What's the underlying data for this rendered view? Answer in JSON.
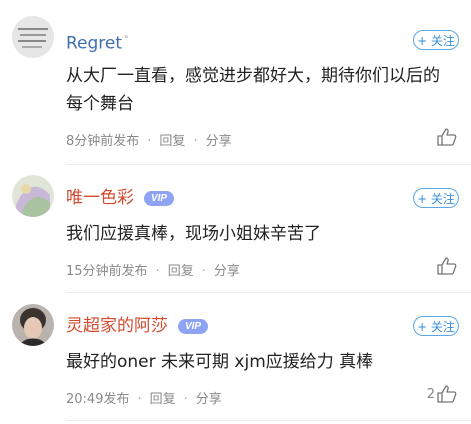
{
  "comments": [
    {
      "username": "Regret",
      "superscript": "°",
      "follow_label": "+ 关注",
      "vip": null,
      "text": "从大厂一直看，感觉进步都好大，期待你们以后的每个舞台",
      "time": "8分钟前发布",
      "reply_label": "回复",
      "share_label": "分享",
      "like_count": ""
    },
    {
      "username": "唯一色彩",
      "superscript": "",
      "follow_label": "+ 关注",
      "vip": "VIP",
      "text": "我们应援真棒，现场小姐妹辛苦了",
      "time": "15分钟前发布",
      "reply_label": "回复",
      "share_label": "分享",
      "like_count": ""
    },
    {
      "username": "灵超家的阿莎",
      "superscript": "",
      "follow_label": "+ 关注",
      "vip": "VIP",
      "text": "最好的oner  未来可期 xjm应援给力 真棒",
      "time": "20:49发布",
      "reply_label": "回复",
      "share_label": "分享",
      "like_count": "2"
    }
  ],
  "colors": {
    "name_normal": "#3f6fb0",
    "name_vip": "#d24b2e",
    "vip_badge": "#8fa3f5",
    "follow": "#3a8fd8",
    "meta": "#8a8a8a"
  }
}
